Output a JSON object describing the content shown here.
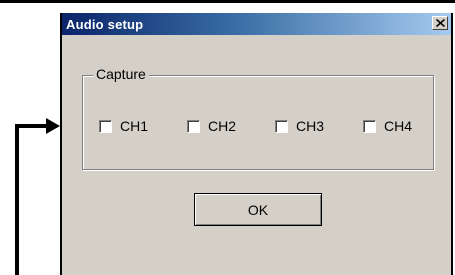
{
  "dialog": {
    "title": "Audio setup",
    "close_icon": "close-icon"
  },
  "capture": {
    "label": "Capture",
    "channels": [
      {
        "label": "CH1",
        "checked": false
      },
      {
        "label": "CH2",
        "checked": false
      },
      {
        "label": "CH3",
        "checked": false
      },
      {
        "label": "CH4",
        "checked": false
      }
    ]
  },
  "buttons": {
    "ok_label": "OK"
  },
  "colors": {
    "titlebar_start": "#0a246a",
    "titlebar_end": "#a6caf0",
    "dialog_bg": "#d4d0c8",
    "callout_arrow": "#000000"
  }
}
